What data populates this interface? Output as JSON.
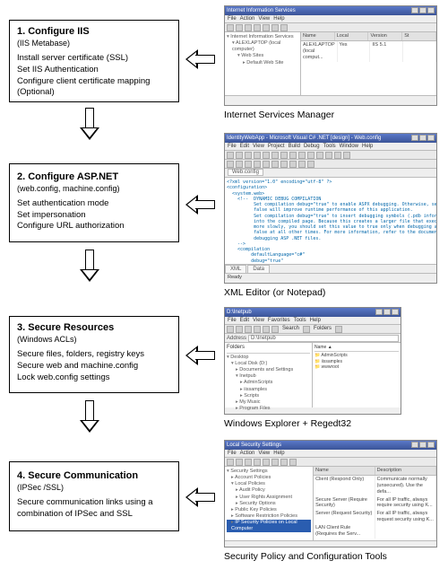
{
  "steps": [
    {
      "title": "1. Configure IIS",
      "subtitle": "(IIS Metabase)",
      "body": "Install server certificate (SSL)\nSet IIS Authentication\nConfigure client certificate mapping (Optional)"
    },
    {
      "title": "2. Configure ASP.NET",
      "subtitle": "(web.config, machine.config)",
      "body": "Set authentication mode\nSet impersonation\nConfigure URL authorization"
    },
    {
      "title": "3. Secure Resources",
      "subtitle": "(Windows ACLs)",
      "body": "Secure files, folders, registry keys\nSecure web and machine.config\nLock web.config settings"
    },
    {
      "title": "4. Secure Communication",
      "subtitle": "(IPSec /SSL)",
      "body": "Secure communication links using a combination of IPSec and SSL"
    }
  ],
  "captions": {
    "s1": "Internet Services Manager",
    "s2": "XML Editor (or Notepad)",
    "s3": "Windows Explorer + Regedt32",
    "s4": "Security Policy and Configuration Tools"
  },
  "shots": {
    "iis": {
      "title": "Internet Information Services",
      "menu": [
        "File",
        "Action",
        "View",
        "Help"
      ],
      "cols": [
        "Name",
        "Local",
        "Version",
        "St"
      ],
      "row": [
        "ALEXLAPTOP (local comput...",
        "Yes",
        "IIS 5.1",
        ""
      ],
      "tree": [
        "Internet Information Services",
        "ALEXLAPTOP (local computer)",
        "Web Sites",
        "Default Web Site"
      ]
    },
    "vs": {
      "title": "IdentityWebApp - Microsoft Visual C# .NET [design] - Web.config",
      "menu": [
        "File",
        "Edit",
        "View",
        "Project",
        "Build",
        "Debug",
        "Tools",
        "Window",
        "Help"
      ],
      "tab": "Web.config",
      "code": "<?xml version=\"1.0\" encoding=\"utf-8\" ?>\n<configuration>\n  <system.web>\n    <!--  DYNAMIC DEBUG COMPILATION\n          Set compilation debug=\"true\" to enable ASPX debugging. Otherwise, setting this v\n          false will improve runtime performance of this application.\n          Set compilation debug=\"true\" to insert debugging symbols (.pdb information)\n          into the compiled page. Because this creates a larger file that executes\n          more slowly, you should set this value to true only when debugging and to\n          false at all other times. For more information, refer to the documentation about\n          debugging ASP .NET files.\n    -->\n    <compilation\n         defaultLanguage=\"c#\"\n         debug=\"true\"\n    />\n    <!--  CUSTOM ERROR MESSAGES",
      "bottom_tabs": [
        "XML",
        "Data"
      ],
      "status": "Ready"
    },
    "explorer": {
      "title": "D:\\Inetpub",
      "menu": [
        "File",
        "Edit",
        "View",
        "Favorites",
        "Tools",
        "Help"
      ],
      "address_label": "Address",
      "address_value": "D:\\Inetpub",
      "folders_label": "Folders",
      "tree": [
        "Desktop",
        "Local Disk (D:)",
        "Documents and Settings",
        "Inetpub",
        "AdminScripts",
        "iissamples",
        "Scripts",
        "My Music",
        "Program Files"
      ],
      "items": [
        "AdminScripts",
        "iissamples",
        "wwwroot"
      ]
    },
    "secpol": {
      "title": "Local Security Settings",
      "menu": [
        "File",
        "Action",
        "View",
        "Help"
      ],
      "tree": [
        "Security Settings",
        "Account Policies",
        "Local Policies",
        "Audit Policy",
        "User Rights Assignment",
        "Security Options",
        "Public Key Policies",
        "Software Restriction Policies",
        "IP Security Policies on Local Computer"
      ],
      "cols": [
        "Name",
        "Description"
      ],
      "rows": [
        [
          "Client (Respond Only)",
          "Communicate normally (unsecured). Use the defa..."
        ],
        [
          "Secure Server (Require Security)",
          "For all IP traffic, always require security using K..."
        ],
        [
          "Server (Request Security)",
          "For all IP traffic, always request security using K..."
        ],
        [
          "LAN Client Rule (Requires the Serv...",
          ""
        ]
      ]
    }
  }
}
